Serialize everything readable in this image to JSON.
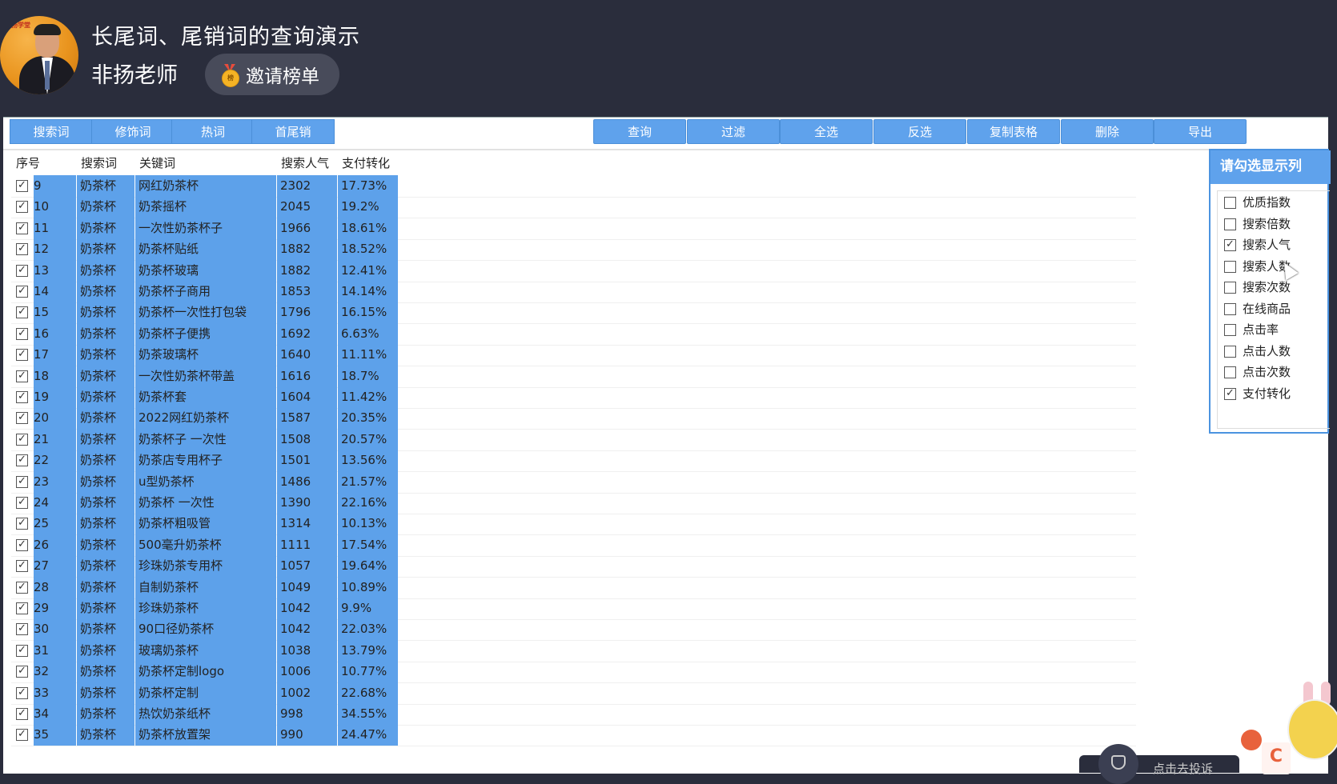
{
  "header": {
    "title": "长尾词、尾销词的查询演示",
    "teacher": "非扬老师",
    "invite_label": "邀请榜单",
    "medal_text": "榜",
    "avatar_brand": "非扬学堂"
  },
  "tabs": [
    "搜索词",
    "修饰词",
    "热词",
    "首尾销"
  ],
  "toolbar": [
    "查询",
    "过滤",
    "全选",
    "反选",
    "复制表格",
    "删除",
    "导出"
  ],
  "table": {
    "headers": [
      "序号",
      "搜索词",
      "关键词",
      "搜索人气",
      "支付转化"
    ],
    "rows": [
      {
        "no": "9",
        "word": "奶茶杯",
        "keyword": "网红奶茶杯",
        "popularity": "2302",
        "conversion": "17.73%"
      },
      {
        "no": "10",
        "word": "奶茶杯",
        "keyword": "奶茶摇杯",
        "popularity": "2045",
        "conversion": "19.2%"
      },
      {
        "no": "11",
        "word": "奶茶杯",
        "keyword": "一次性奶茶杯子",
        "popularity": "1966",
        "conversion": "18.61%"
      },
      {
        "no": "12",
        "word": "奶茶杯",
        "keyword": "奶茶杯贴纸",
        "popularity": "1882",
        "conversion": "18.52%"
      },
      {
        "no": "13",
        "word": "奶茶杯",
        "keyword": "奶茶杯玻璃",
        "popularity": "1882",
        "conversion": "12.41%"
      },
      {
        "no": "14",
        "word": "奶茶杯",
        "keyword": "奶茶杯子商用",
        "popularity": "1853",
        "conversion": "14.14%"
      },
      {
        "no": "15",
        "word": "奶茶杯",
        "keyword": "奶茶杯一次性打包袋",
        "popularity": "1796",
        "conversion": "16.15%"
      },
      {
        "no": "16",
        "word": "奶茶杯",
        "keyword": "奶茶杯子便携",
        "popularity": "1692",
        "conversion": "6.63%"
      },
      {
        "no": "17",
        "word": "奶茶杯",
        "keyword": "奶茶玻璃杯",
        "popularity": "1640",
        "conversion": "11.11%"
      },
      {
        "no": "18",
        "word": "奶茶杯",
        "keyword": "一次性奶茶杯带盖",
        "popularity": "1616",
        "conversion": "18.7%"
      },
      {
        "no": "19",
        "word": "奶茶杯",
        "keyword": "奶茶杯套",
        "popularity": "1604",
        "conversion": "11.42%"
      },
      {
        "no": "20",
        "word": "奶茶杯",
        "keyword": "2022网红奶茶杯",
        "popularity": "1587",
        "conversion": "20.35%"
      },
      {
        "no": "21",
        "word": "奶茶杯",
        "keyword": "奶茶杯子 一次性",
        "popularity": "1508",
        "conversion": "20.57%"
      },
      {
        "no": "22",
        "word": "奶茶杯",
        "keyword": "奶茶店专用杯子",
        "popularity": "1501",
        "conversion": "13.56%"
      },
      {
        "no": "23",
        "word": "奶茶杯",
        "keyword": "u型奶茶杯",
        "popularity": "1486",
        "conversion": "21.57%"
      },
      {
        "no": "24",
        "word": "奶茶杯",
        "keyword": "奶茶杯 一次性",
        "popularity": "1390",
        "conversion": "22.16%"
      },
      {
        "no": "25",
        "word": "奶茶杯",
        "keyword": "奶茶杯粗吸管",
        "popularity": "1314",
        "conversion": "10.13%"
      },
      {
        "no": "26",
        "word": "奶茶杯",
        "keyword": "500毫升奶茶杯",
        "popularity": "1111",
        "conversion": "17.54%"
      },
      {
        "no": "27",
        "word": "奶茶杯",
        "keyword": "珍珠奶茶专用杯",
        "popularity": "1057",
        "conversion": "19.64%"
      },
      {
        "no": "28",
        "word": "奶茶杯",
        "keyword": "自制奶茶杯",
        "popularity": "1049",
        "conversion": "10.89%"
      },
      {
        "no": "29",
        "word": "奶茶杯",
        "keyword": "珍珠奶茶杯",
        "popularity": "1042",
        "conversion": "9.9%"
      },
      {
        "no": "30",
        "word": "奶茶杯",
        "keyword": "90口径奶茶杯",
        "popularity": "1042",
        "conversion": "22.03%"
      },
      {
        "no": "31",
        "word": "奶茶杯",
        "keyword": "玻璃奶茶杯",
        "popularity": "1038",
        "conversion": "13.79%"
      },
      {
        "no": "32",
        "word": "奶茶杯",
        "keyword": "奶茶杯定制logo",
        "popularity": "1006",
        "conversion": "10.77%"
      },
      {
        "no": "33",
        "word": "奶茶杯",
        "keyword": "奶茶杯定制",
        "popularity": "1002",
        "conversion": "22.68%"
      },
      {
        "no": "34",
        "word": "奶茶杯",
        "keyword": "热饮奶茶纸杯",
        "popularity": "998",
        "conversion": "34.55%"
      },
      {
        "no": "35",
        "word": "奶茶杯",
        "keyword": "奶茶杯放置架",
        "popularity": "990",
        "conversion": "24.47%"
      }
    ]
  },
  "column_panel": {
    "title": "请勾选显示列",
    "options": [
      {
        "label": "优质指数",
        "checked": false
      },
      {
        "label": "搜索倍数",
        "checked": false
      },
      {
        "label": "搜索人气",
        "checked": true
      },
      {
        "label": "搜索人数",
        "checked": false
      },
      {
        "label": "搜索次数",
        "checked": false
      },
      {
        "label": "在线商品",
        "checked": false
      },
      {
        "label": "点击率",
        "checked": false
      },
      {
        "label": "点击人数",
        "checked": false
      },
      {
        "label": "点击次数",
        "checked": false
      },
      {
        "label": "支付转化",
        "checked": true
      }
    ]
  },
  "dock": {
    "text": "点击去投诉"
  },
  "mascot": {
    "bag_letter": "C"
  },
  "colors": {
    "selection": "#5da1ea",
    "button": "#5fa2ec",
    "header_bg": "#2a2d3c"
  }
}
